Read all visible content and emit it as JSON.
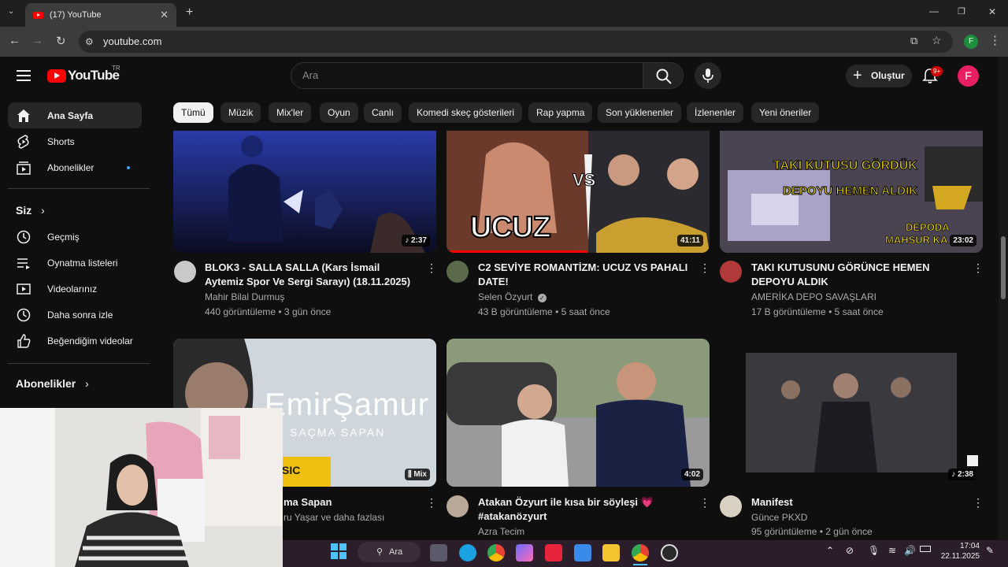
{
  "browser": {
    "tab_title": "(17) YouTube",
    "url": "youtube.com",
    "profile_initial": "F"
  },
  "header": {
    "logo_text": "YouTube",
    "country_code": "TR",
    "search_placeholder": "Ara",
    "create_label": "Oluştur",
    "notifications_badge": "9+",
    "avatar_initial": "F"
  },
  "sidebar": {
    "main": [
      {
        "label": "Ana Sayfa",
        "icon": "home-icon"
      },
      {
        "label": "Shorts",
        "icon": "shorts-icon"
      },
      {
        "label": "Abonelikler",
        "icon": "subscriptions-icon"
      }
    ],
    "you_heading": "Siz",
    "you_items": [
      {
        "label": "Geçmiş",
        "icon": "history-icon"
      },
      {
        "label": "Oynatma listeleri",
        "icon": "playlists-icon"
      },
      {
        "label": "Videolarınız",
        "icon": "your-videos-icon"
      },
      {
        "label": "Daha sonra izle",
        "icon": "watch-later-icon"
      },
      {
        "label": "Beğendiğim videolar",
        "icon": "liked-icon"
      }
    ],
    "subscriptions_heading": "Abonelikler"
  },
  "chips": [
    "Tümü",
    "Müzik",
    "Mix'ler",
    "Oyun",
    "Canlı",
    "Komedi skeç gösterileri",
    "Rap yapma",
    "Son yüklenenler",
    "İzlenenler",
    "Yeni öneriler"
  ],
  "videos": [
    {
      "title": "BLOK3 - SALLA SALLA (Kars İsmail Aytemiz Spor Ve Sergi Sarayı) (18.11.2025)",
      "channel": "Mahir Bilal Durmuş",
      "meta": "440 görüntüleme • 3 gün önce",
      "duration": "♪ 2:37",
      "thumb_caption": ""
    },
    {
      "title": "C2 SEVİYE ROMANTİZM: UCUZ VS PAHALI DATE!",
      "channel": "Selen Özyurt",
      "meta": "43 B görüntüleme • 5 saat önce",
      "duration": "41:11",
      "thumb_caption": "UCUZ",
      "thumb_vs": "VS"
    },
    {
      "title": "TAKI KUTUSUNU GÖRÜNCE HEMEN DEPOYU ALDIK",
      "channel": "AMERİKA DEPO SAVAŞLARI",
      "meta": "17 B görüntüleme • 5 saat önce",
      "duration": "23:02",
      "thumb_caption": "TAKI KUTUSU GÖRDÜK",
      "thumb_caption2": "DEPOYU HEMEN ALDIK",
      "thumb_caption3": "DEPODA",
      "thumb_caption4": "MAHSUR KA"
    },
    {
      "title": "Emir Şamur - Saçma Sapan",
      "title_visible": "ma Sapan",
      "channel": "ru Yaşar ve daha fazlası",
      "duration": "Mix",
      "thumb_caption": "EmirŞamur",
      "thumb_caption2": "SAÇMA SAPAN",
      "thumb_caption3": "SIC"
    },
    {
      "title": "Atakan Özyurt ile kısa bir söyleşi 💗 #atakanözyurt",
      "channel": "Azra Tecim",
      "duration": "4:02"
    },
    {
      "title": "Manifest",
      "channel": "Günce PKXD",
      "meta": "95 görüntüleme • 2 gün önce",
      "duration": "♪ 2:38"
    }
  ],
  "taskbar": {
    "search_label": "Ara",
    "time": "17:04",
    "date": "22.11.2025"
  }
}
